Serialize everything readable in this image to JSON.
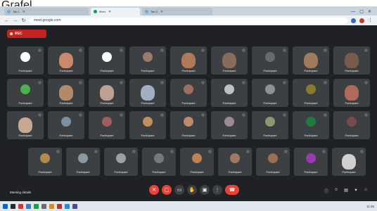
{
  "caption": "Grafel",
  "browser": {
    "tabs": [
      {
        "label": "Tab 1",
        "color": "#7aa6d1",
        "active": false
      },
      {
        "label": "Meet",
        "color": "#0f9d58",
        "active": true
      },
      {
        "label": "Tab 3",
        "color": "#7aa6d1",
        "active": false
      }
    ],
    "url": "meet.google.com"
  },
  "meet": {
    "recording_label": "REC",
    "bottom_left_label": "Meeting details",
    "tiles": [
      {
        "name": "Participant",
        "kind": "avatar",
        "color": "#ffffff"
      },
      {
        "name": "Participant",
        "kind": "video",
        "color": "#c98a6a"
      },
      {
        "name": "Participant",
        "kind": "avatar",
        "color": "#ffffff"
      },
      {
        "name": "Participant",
        "kind": "avatar",
        "color": "#9b7b6a"
      },
      {
        "name": "Participant",
        "kind": "video",
        "color": "#b07a5a"
      },
      {
        "name": "Participant",
        "kind": "video",
        "color": "#8a6a5a"
      },
      {
        "name": "Participant",
        "kind": "avatar",
        "color": "#6a6a6a"
      },
      {
        "name": "Participant",
        "kind": "video",
        "color": "#a07a5a"
      },
      {
        "name": "Participant",
        "kind": "video",
        "color": "#7a5a4a"
      },
      {
        "name": "Participant",
        "kind": "avatar",
        "color": "#4caf50"
      },
      {
        "name": "Participant",
        "kind": "video",
        "color": "#b08a6a"
      },
      {
        "name": "Participant",
        "kind": "video",
        "color": "#c0a090"
      },
      {
        "name": "Participant",
        "kind": "video",
        "color": "#a0b0c0"
      },
      {
        "name": "Participant",
        "kind": "avatar",
        "color": "#9a7060"
      },
      {
        "name": "Participant",
        "kind": "avatar",
        "color": "#c0c0c0"
      },
      {
        "name": "Participant",
        "kind": "avatar",
        "color": "#909090"
      },
      {
        "name": "Participant",
        "kind": "avatar",
        "color": "#8a7a30"
      },
      {
        "name": "Participant",
        "kind": "video",
        "color": "#b06a5a"
      },
      {
        "name": "Participant",
        "kind": "video",
        "color": "#c8a890"
      },
      {
        "name": "Participant",
        "kind": "avatar",
        "color": "#7a90a0"
      },
      {
        "name": "Participant",
        "kind": "avatar",
        "color": "#a06060"
      },
      {
        "name": "Participant",
        "kind": "avatar",
        "color": "#c09060"
      },
      {
        "name": "Participant",
        "kind": "avatar",
        "color": "#c08a70"
      },
      {
        "name": "Participant",
        "kind": "avatar",
        "color": "#9a8a90"
      },
      {
        "name": "Participant",
        "kind": "avatar",
        "color": "#8a9a70"
      },
      {
        "name": "Participant",
        "kind": "avatar",
        "color": "#1e7a3a"
      },
      {
        "name": "Participant",
        "kind": "avatar",
        "color": "#7a4a4a"
      },
      {
        "name": "Participant",
        "kind": "avatar",
        "color": "#b08a50"
      },
      {
        "name": "Participant",
        "kind": "avatar",
        "color": "#8a9aa0"
      },
      {
        "name": "Participant",
        "kind": "avatar",
        "color": "#a0a0a0"
      },
      {
        "name": "Participant",
        "kind": "avatar",
        "color": "#707a80"
      },
      {
        "name": "Participant",
        "kind": "avatar",
        "color": "#c08050"
      },
      {
        "name": "Participant",
        "kind": "avatar",
        "color": "#a07a60"
      },
      {
        "name": "Participant",
        "kind": "avatar",
        "color": "#9a7050"
      },
      {
        "name": "Participant",
        "kind": "avatar",
        "color": "#9a3ab0"
      },
      {
        "name": "Participant",
        "kind": "video",
        "color": "#d0d0d0"
      }
    ],
    "controls": [
      {
        "name": "mic-off-icon",
        "glyph": "✕",
        "red": true
      },
      {
        "name": "camera-off-icon",
        "glyph": "▢",
        "red": true
      },
      {
        "name": "captions-icon",
        "glyph": "▭",
        "red": false
      },
      {
        "name": "raise-hand-icon",
        "glyph": "✋",
        "red": false
      },
      {
        "name": "present-icon",
        "glyph": "▣",
        "red": false
      },
      {
        "name": "more-options-icon",
        "glyph": "⋮",
        "red": false
      }
    ],
    "end_call_glyph": "☎",
    "right_icons": [
      {
        "name": "info-icon",
        "glyph": "ⓘ"
      },
      {
        "name": "people-icon",
        "glyph": "☺"
      },
      {
        "name": "chat-icon",
        "glyph": "▤"
      },
      {
        "name": "activities-icon",
        "glyph": "✦"
      },
      {
        "name": "lock-icon",
        "glyph": "⌂"
      }
    ]
  },
  "taskbar": {
    "icons": [
      "#0a64c8",
      "#2a2a2a",
      "#c83a3a",
      "#3a7ac8",
      "#1e9a4a",
      "#6a6a6a",
      "#d08a2a",
      "#c0302a",
      "#2a8ad0",
      "#4a4a9a"
    ],
    "clock": "11:45"
  }
}
